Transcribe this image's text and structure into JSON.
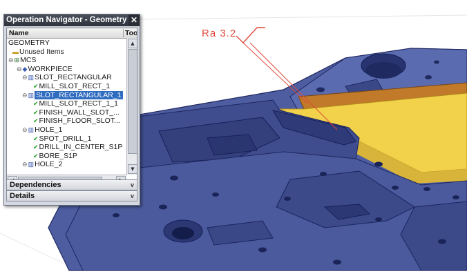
{
  "annotation": {
    "roughness": "Ra 3.2"
  },
  "navigator": {
    "title": "Operation Navigator - Geometry",
    "close_glyph": "✕",
    "columns": [
      "Name",
      "Too"
    ],
    "rows": [
      {
        "label": "GEOMETRY",
        "icon": "",
        "icon_name": "none"
      },
      {
        "label": "Unused Items",
        "icon": "▬",
        "icon_name": "unused-items-icon"
      },
      {
        "label": "MCS",
        "icon": "⊞",
        "icon_name": "mcs-icon"
      },
      {
        "label": "WORKPIECE",
        "icon": "◆",
        "icon_name": "workpiece-icon"
      },
      {
        "label": "SLOT_RECTANGULAR",
        "icon": "▥",
        "icon_name": "feature-group-icon"
      },
      {
        "label": "MILL_SLOT_RECT_1",
        "icon": "✔",
        "icon_name": "mill-operation-icon"
      },
      {
        "label": "SLOT_RECTANGULAR_1",
        "icon": "▥",
        "icon_name": "feature-group-icon",
        "selected": true
      },
      {
        "label": "MILL_SLOT_RECT_1_1",
        "icon": "✔",
        "icon_name": "mill-operation-icon"
      },
      {
        "label": "FINISH_WALL_SLOT_...",
        "icon": "✔",
        "icon_name": "mill-operation-icon"
      },
      {
        "label": "FINISH_FLOOR_SLOT...",
        "icon": "✔",
        "icon_name": "mill-operation-icon"
      },
      {
        "label": "HOLE_1",
        "icon": "▥",
        "icon_name": "feature-group-icon"
      },
      {
        "label": "SPOT_DRILL_1",
        "icon": "✔",
        "icon_name": "drill-operation-icon"
      },
      {
        "label": "DRILL_IN_CENTER_S1P",
        "icon": "✔",
        "icon_name": "drill-operation-icon"
      },
      {
        "label": "BORE_S1P",
        "icon": "✔",
        "icon_name": "drill-operation-icon"
      },
      {
        "label": "HOLE_2",
        "icon": "▥",
        "icon_name": "feature-group-icon"
      }
    ],
    "sections": [
      {
        "label": "Dependencies",
        "chevron": "v"
      },
      {
        "label": "Details",
        "chevron": "v"
      }
    ]
  },
  "colors": {
    "part_top": "#5a6aa8",
    "part_side": "#3f4d8e",
    "part_dark": "#2c3874",
    "highlight_face": "#f2d24a",
    "highlight_wall": "#c07a2a",
    "annotation": "#e04a3a",
    "selection": "#2f6cc0"
  }
}
